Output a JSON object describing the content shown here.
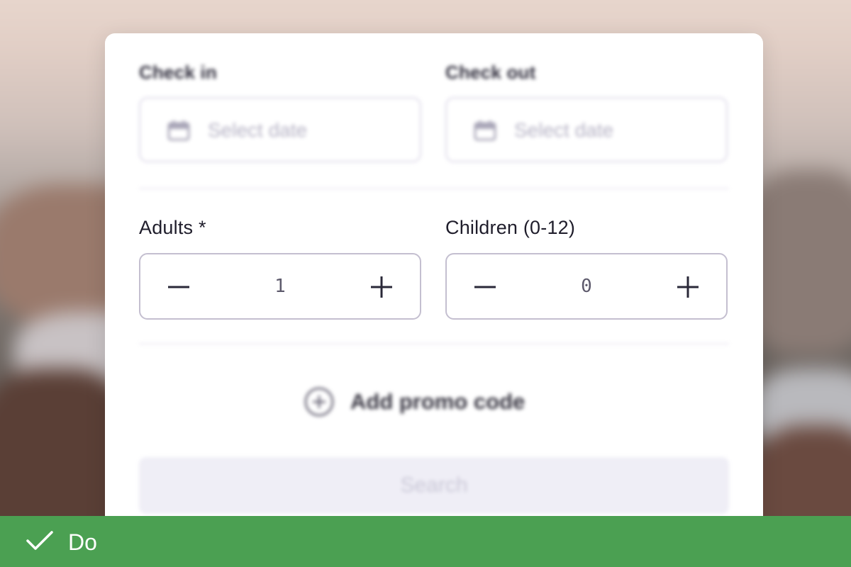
{
  "form": {
    "check_in": {
      "label": "Check in",
      "placeholder": "Select date"
    },
    "check_out": {
      "label": "Check out",
      "placeholder": "Select date"
    },
    "adults": {
      "label": "Adults *",
      "value": "1"
    },
    "children": {
      "label": "Children (0-12)",
      "value": "0"
    },
    "promo_label": "Add promo code",
    "search_label": "Search"
  },
  "banner": {
    "label": "Do",
    "color": "#4ba052"
  },
  "icons": {
    "date": "calendar-icon",
    "decrement": "minus-icon",
    "increment": "plus-icon",
    "promo": "plus-circle-icon",
    "banner": "checkmark-icon"
  }
}
